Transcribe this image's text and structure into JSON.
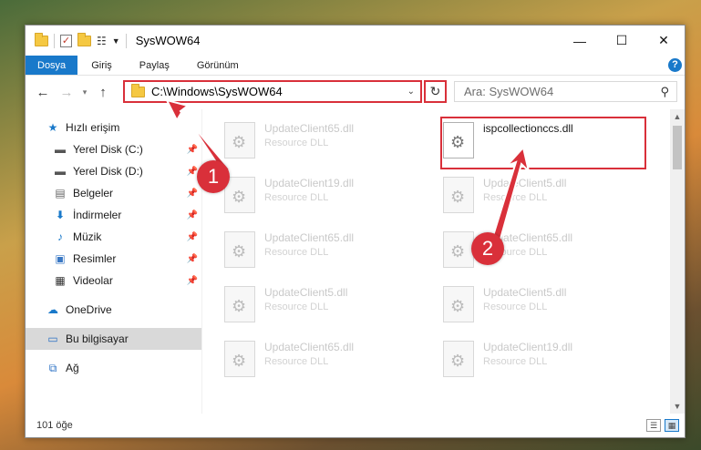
{
  "window": {
    "title": "SysWOW64"
  },
  "ribbon": {
    "tabs": [
      {
        "label": "Dosya",
        "active": true
      },
      {
        "label": "Giriş",
        "active": false
      },
      {
        "label": "Paylaş",
        "active": false
      },
      {
        "label": "Görünüm",
        "active": false
      }
    ],
    "help_label": "?"
  },
  "address": {
    "path": "C:\\Windows\\SysWOW64"
  },
  "search": {
    "placeholder": "Ara: SysWOW64"
  },
  "sidebar": {
    "items": [
      {
        "label": "Hızlı erişim",
        "icon": "star-icon",
        "pinned": false
      },
      {
        "label": "Yerel Disk (C:)",
        "icon": "drive-icon",
        "pinned": true
      },
      {
        "label": "Yerel Disk (D:)",
        "icon": "drive-icon",
        "pinned": true
      },
      {
        "label": "Belgeler",
        "icon": "documents-icon",
        "pinned": true
      },
      {
        "label": "İndirmeler",
        "icon": "downloads-icon",
        "pinned": true
      },
      {
        "label": "Müzik",
        "icon": "music-icon",
        "pinned": true
      },
      {
        "label": "Resimler",
        "icon": "pictures-icon",
        "pinned": true
      },
      {
        "label": "Videolar",
        "icon": "videos-icon",
        "pinned": true
      },
      {
        "label": "OneDrive",
        "icon": "onedrive-icon",
        "pinned": false
      },
      {
        "label": "Bu bilgisayar",
        "icon": "computer-icon",
        "pinned": false,
        "selected": true
      },
      {
        "label": "Ağ",
        "icon": "network-icon",
        "pinned": false
      }
    ]
  },
  "files": [
    {
      "name": "UpdateClient65.dll",
      "type": "Resource DLL"
    },
    {
      "name": "ispcollectionccs.dll",
      "type": "",
      "active": true
    },
    {
      "name": "UpdateClient19.dll",
      "type": "Resource DLL"
    },
    {
      "name": "UpdateClient5.dll",
      "type": "Resource DLL"
    },
    {
      "name": "UpdateClient65.dll",
      "type": "Resource DLL"
    },
    {
      "name": "UpdateClient65.dll",
      "type": "Resource DLL"
    },
    {
      "name": "UpdateClient5.dll",
      "type": "Resource DLL"
    },
    {
      "name": "UpdateClient5.dll",
      "type": "Resource DLL"
    },
    {
      "name": "UpdateClient65.dll",
      "type": "Resource DLL"
    },
    {
      "name": "UpdateClient19.dll",
      "type": "Resource DLL"
    }
  ],
  "status": {
    "item_count": "101 öğe"
  },
  "callouts": {
    "one": "1",
    "two": "2"
  },
  "colors": {
    "accent": "#1979ca",
    "highlight": "#d9303a"
  }
}
